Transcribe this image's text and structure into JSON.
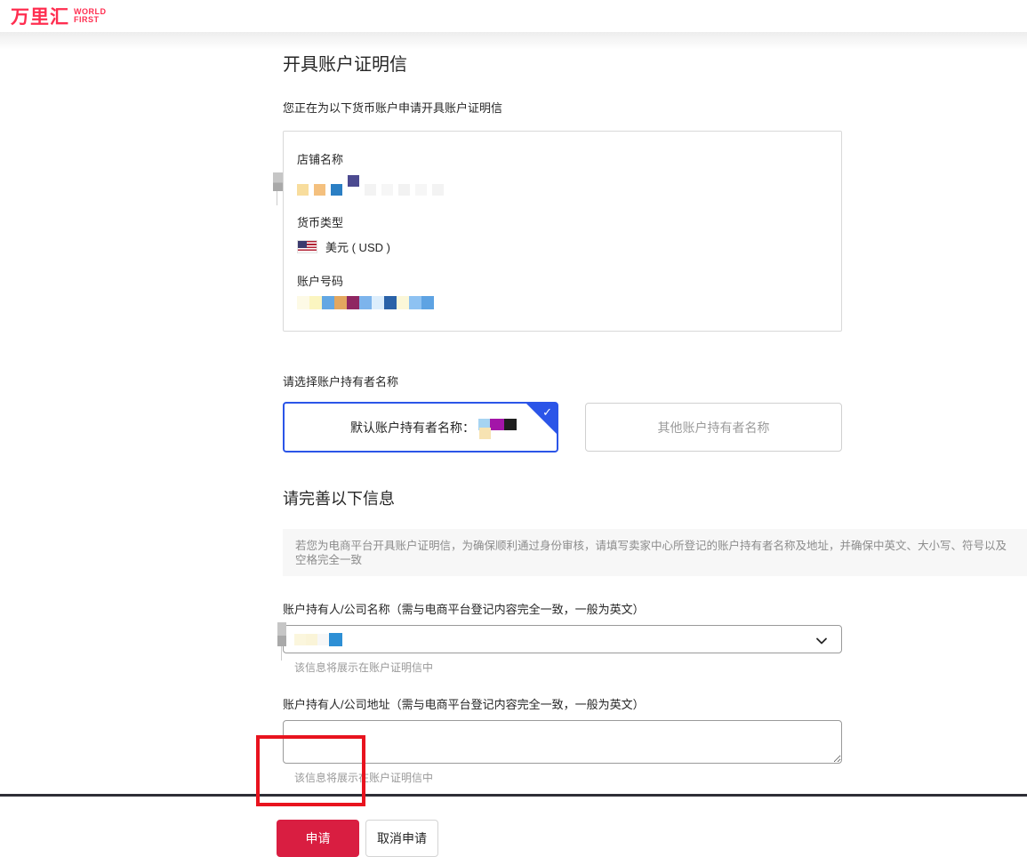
{
  "brand": {
    "logo_cn": "万里汇",
    "logo_en_line1": "WORLD",
    "logo_en_line2": "FIRST",
    "brand_color": "#ff2e50"
  },
  "page": {
    "title": "开具账户证明信",
    "subtitle": "您正在为以下货币账户申请开具账户证明信"
  },
  "account_info": {
    "shop_name_label": "店铺名称",
    "currency_label": "货币类型",
    "currency_value": "美元 ( USD )",
    "currency_flag": "us-flag-icon",
    "account_number_label": "账户号码"
  },
  "holder_select": {
    "label": "请选择账户持有者名称",
    "default_option_label": "默认账户持有者名称：",
    "default_selected": true,
    "other_option_label": "其他账户持有者名称",
    "selected_accent_color": "#2b55e8",
    "check_glyph": "✓"
  },
  "form": {
    "section_title": "请完善以下信息",
    "notice": "若您为电商平台开具账户证明信，为确保顺利通过身份审核，请填写卖家中心所登记的账户持有者名称及地址，并确保中英文、大小写、符号以及空格完全一致",
    "name_label": "账户持有人/公司名称（需与电商平台登记内容完全一致，一般为英文）",
    "name_helper": "该信息将展示在账户证明信中",
    "address_label": "账户持有人/公司地址（需与电商平台登记内容完全一致，一般为英文）",
    "address_value": "",
    "address_helper": "该信息将展示在账户证明信中"
  },
  "buttons": {
    "submit_label": "申请",
    "submit_color": "#d91e41",
    "cancel_label": "取消申请"
  },
  "annotation": {
    "highlight_color": "#e8131e",
    "highlight_target": "submit-button"
  },
  "redactions": {
    "shop_name": [
      {
        "c": "#f8dd9d"
      },
      {
        "c": "#f4c07e"
      },
      {
        "c": "#2b7fc4"
      },
      {
        "c": "#4c4a90",
        "y": -10
      },
      {
        "c": "#f3f3f3"
      },
      {
        "c": "#f6f6f6"
      },
      {
        "c": "#f2f2f2"
      },
      {
        "c": "#f6f6f6"
      },
      {
        "c": "#f3f3f3"
      }
    ],
    "account_number": [
      {
        "c": "#fdfae6"
      },
      {
        "c": "#fbf5c0"
      },
      {
        "c": "#63a7e3"
      },
      {
        "c": "#e3a75f"
      },
      {
        "c": "#8f2762"
      },
      {
        "c": "#7db4ec"
      },
      {
        "c": "#ddeefc"
      },
      {
        "c": "#2a62a8"
      },
      {
        "c": "#fbf7d8"
      },
      {
        "c": "#8ec2f2"
      },
      {
        "c": "#5ea3e3"
      }
    ],
    "default_holder_name": [
      {
        "c": "#a6d4f2",
        "h": 13
      },
      {
        "c": "#a315a8",
        "w": 16,
        "h": 13
      },
      {
        "c": "#1f1f1f",
        "w": 14,
        "h": 13
      },
      {
        "c": "#f7e3b2",
        "y": 10,
        "ml": -42
      }
    ],
    "name_field_value": [
      {
        "c": "#fbf6dd"
      },
      {
        "c": "#faf4d8"
      },
      {
        "c": "#f7f7f7"
      },
      {
        "c": "#2d8fd5",
        "w": 15,
        "h": 15
      }
    ]
  }
}
